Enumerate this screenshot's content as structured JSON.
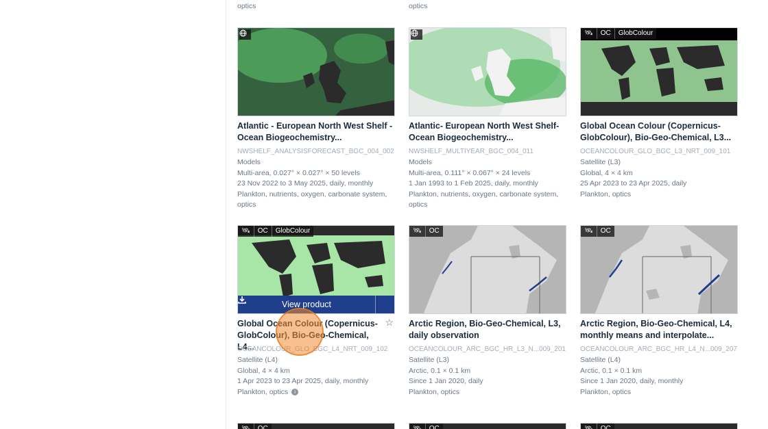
{
  "top_row": {
    "col1": "optics",
    "col2": "optics"
  },
  "cards": [
    {
      "title": "Atlantic - European North West Shelf - Ocean Biogeochemistry...",
      "id": "NWSHELF_ANALYSISFORECAST_BGC_004_002",
      "type": "Models",
      "resolution": "Multi-area, 0.027° × 0.027° × 50 levels",
      "period": "23 Nov 2022 to 3 May 2025, daily, monthly",
      "variables": "Plankton, nutrients, oxygen, carbonate system, optics"
    },
    {
      "title": "Atlantic- European North West Shelf- Ocean Biogeochemistry...",
      "id": "NWSHELF_MULTIYEAR_BGC_004_011",
      "type": "Models",
      "resolution": "Multi-area, 0.111° × 0.067° × 24 levels",
      "period": "1 Jan 1993 to 1 Feb 2025, daily, monthly",
      "variables": "Plankton, nutrients, oxygen, carbonate system, optics"
    },
    {
      "title": "Global Ocean Colour (Copernicus-GlobColour), Bio-Geo-Chemical, L3...",
      "id": "OCEANCOLOUR_GLO_BGC_L3_NRT_009_101",
      "type": "Satellite (L3)",
      "resolution": "Global, 4 × 4 km",
      "period": "25 Apr 2023 to 23 Apr 2025, daily",
      "variables": "Plankton, optics",
      "tags": [
        "OC",
        "GlobColour"
      ]
    },
    {
      "title": "Global Ocean Colour (Copernicus-GlobColour), Bio-Geo-Chemical, L4...",
      "id": "OCEANCOLOUR_GLO_BGC_L4_NRT_009_102",
      "type": "Satellite (L4)",
      "resolution": "Global, 4 × 4 km",
      "period": "1 Apr 2023 to 23 Apr 2025, daily, monthly",
      "variables": "Plankton, optics",
      "tags": [
        "OC",
        "GlobColour"
      ],
      "view_label": "View product"
    },
    {
      "title": "Arctic Region, Bio-Geo-Chemical, L3, daily observation",
      "id": "OCEANCOLOUR_ARC_BGC_HR_L3_N...009_201",
      "type": "Satellite (L3)",
      "resolution": "Arctic, 0.1 × 0.1 km",
      "period": "Since 1 Jan 2020, daily",
      "variables": "Plankton, optics",
      "tags": [
        "OC"
      ]
    },
    {
      "title": "Arctic Region, Bio-Geo-Chemical, L4, monthly means and interpolate...",
      "id": "OCEANCOLOUR_ARC_BGC_HR_L4_N...009_207",
      "type": "Satellite (L4)",
      "resolution": "Arctic, 0.1 × 0.1 km",
      "period": "Since 1 Jan 2020, daily, monthly",
      "variables": "Plankton, optics",
      "tags": [
        "OC"
      ]
    }
  ],
  "bottom_tags": [
    "OC",
    "OC",
    "OC"
  ],
  "colors": {
    "accent": "#1f3e8c",
    "ocean_dark": "#2b2b2b",
    "chl_green": "#3aa655",
    "land_grey": "#b5b5b5"
  }
}
